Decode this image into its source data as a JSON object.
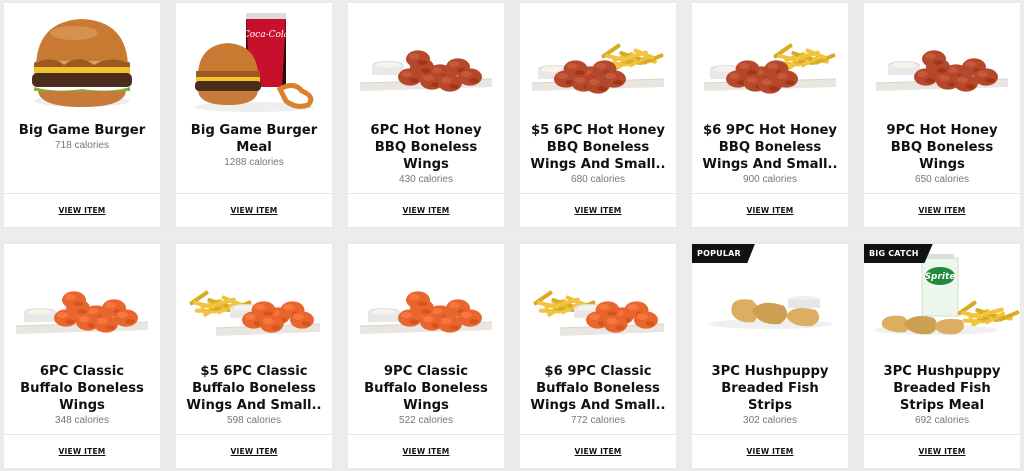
{
  "menu": {
    "view_label": "VIEW ITEM",
    "items": [
      {
        "name": "Big Game Burger",
        "calories": "718 calories",
        "badge": "",
        "image": "burger"
      },
      {
        "name": "Big Game Burger\nMeal",
        "calories": "1288 calories",
        "badge": "",
        "image": "burger-meal"
      },
      {
        "name": "6PC Hot Honey\nBBQ Boneless\nWings",
        "calories": "430 calories",
        "badge": "",
        "image": "bbq-wings"
      },
      {
        "name": "$5 6PC Hot Honey\nBBQ Boneless\nWings And Small..",
        "calories": "680 calories",
        "badge": "",
        "image": "bbq-wings-fries"
      },
      {
        "name": "$6 9PC Hot Honey\nBBQ Boneless\nWings And Small..",
        "calories": "900 calories",
        "badge": "",
        "image": "bbq-wings-fries"
      },
      {
        "name": "9PC Hot Honey\nBBQ Boneless\nWings",
        "calories": "650 calories",
        "badge": "",
        "image": "bbq-wings"
      },
      {
        "name": "6PC Classic\nBuffalo Boneless\nWings",
        "calories": "348 calories",
        "badge": "",
        "image": "buffalo-wings"
      },
      {
        "name": "$5 6PC Classic\nBuffalo Boneless\nWings And Small..",
        "calories": "598 calories",
        "badge": "",
        "image": "buffalo-wings-fries"
      },
      {
        "name": "9PC Classic\nBuffalo Boneless\nWings",
        "calories": "522 calories",
        "badge": "",
        "image": "buffalo-wings"
      },
      {
        "name": "$6 9PC Classic\nBuffalo Boneless\nWings And Small..",
        "calories": "772 calories",
        "badge": "",
        "image": "buffalo-wings-fries"
      },
      {
        "name": "3PC Hushpuppy\nBreaded Fish\nStrips",
        "calories": "302 calories",
        "badge": "POPULAR",
        "image": "fish-strips"
      },
      {
        "name": "3PC Hushpuppy\nBreaded Fish\nStrips Meal",
        "calories": "692 calories",
        "badge": "BIG CATCH",
        "image": "fish-meal"
      }
    ]
  },
  "images": {
    "cup_logo_1": "Coca-Cola",
    "cup_logo_2": "Sprite"
  },
  "colors": {
    "badge_bg": "#111111",
    "sauce_bbq": "#b5482a",
    "sauce_buffalo": "#e8662e",
    "fries": "#f2c43e",
    "breading": "#dcae62"
  }
}
